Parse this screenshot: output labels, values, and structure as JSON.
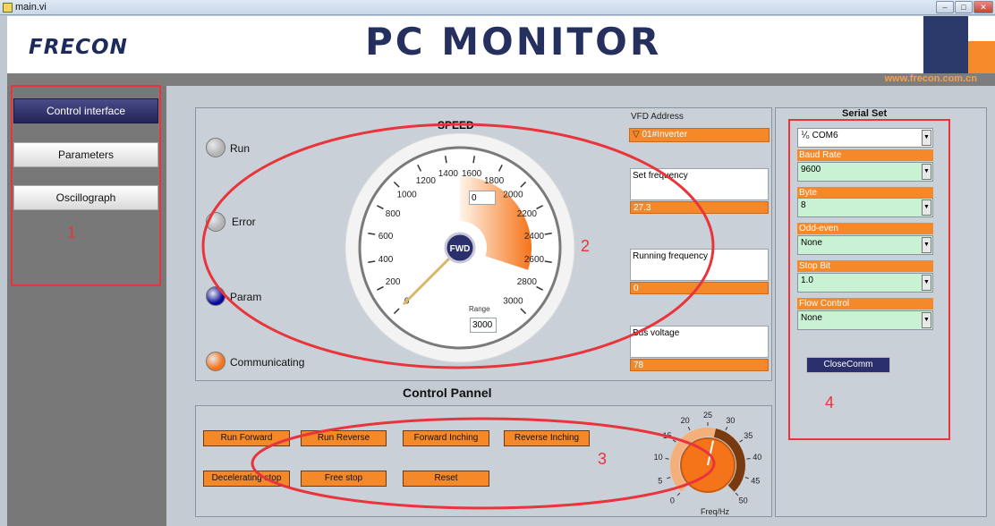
{
  "window": {
    "title": "main.vi",
    "minimize": "–",
    "maximize": "□",
    "close": "✕"
  },
  "header": {
    "logo": "FRECON",
    "title": "PC MONITOR",
    "url": "www.frecon.com.cn"
  },
  "sidebar": {
    "items": [
      {
        "label": "Control interface",
        "active": true
      },
      {
        "label": "Parameters",
        "active": false
      },
      {
        "label": "Oscillograph",
        "active": false
      }
    ]
  },
  "indicators": [
    {
      "label": "Run",
      "color": "#b3b3b3"
    },
    {
      "label": "Error",
      "color": "#b3b3b3"
    },
    {
      "label": "Param",
      "color": "#0a0a9a"
    },
    {
      "label": "Communicating",
      "color": "#f5741a"
    }
  ],
  "gauge": {
    "title": "SPEED",
    "current_value": "0",
    "center_label": "FWD",
    "range_label": "Range",
    "range_value": "3000",
    "ticks": [
      "0",
      "200",
      "400",
      "600",
      "800",
      "1000",
      "1200",
      "1400",
      "1600",
      "1800",
      "2000",
      "2200",
      "2400",
      "2600",
      "2800",
      "3000"
    ],
    "max": 3000,
    "needle_value": 0,
    "arc_fill_from": 1500,
    "arc_fill_to": 2700
  },
  "vfd": {
    "address_label": "VFD Address",
    "address_value": "01#Inverter",
    "set_freq_label": "Set frequency",
    "set_freq_value": "27.3",
    "running_freq_label": "Running frequency",
    "running_freq_value": "0",
    "bus_voltage_label": "Bus voltage",
    "bus_voltage_value": "78"
  },
  "control": {
    "title": "Control Pannel",
    "buttons": [
      "Run Forward",
      "Run Reverse",
      "Forward Inching",
      "Reverse Inching",
      "Decelerating stop",
      "Free stop",
      "Reset"
    ]
  },
  "knob": {
    "label": "Freq/Hz",
    "ticks": [
      "0",
      "5",
      "10",
      "15",
      "20",
      "25",
      "30",
      "35",
      "40",
      "45",
      "50"
    ],
    "value": 27.3,
    "max": 50
  },
  "serial": {
    "title": "Serial Set",
    "port": "COM6",
    "port_prefix": "⅟₀",
    "fields": [
      {
        "label": "Baud Rate",
        "value": "9600"
      },
      {
        "label": "Byte",
        "value": "8"
      },
      {
        "label": "Odd-even",
        "value": "None"
      },
      {
        "label": "Stop Bit",
        "value": "1.0"
      },
      {
        "label": "Flow Control",
        "value": "None"
      }
    ],
    "close_button": "CloseComm"
  },
  "annotations": [
    "1",
    "2",
    "3",
    "4"
  ],
  "colors": {
    "accent": "#f5892a",
    "navy": "#2b3a6b",
    "annotation": "#e8343a"
  }
}
